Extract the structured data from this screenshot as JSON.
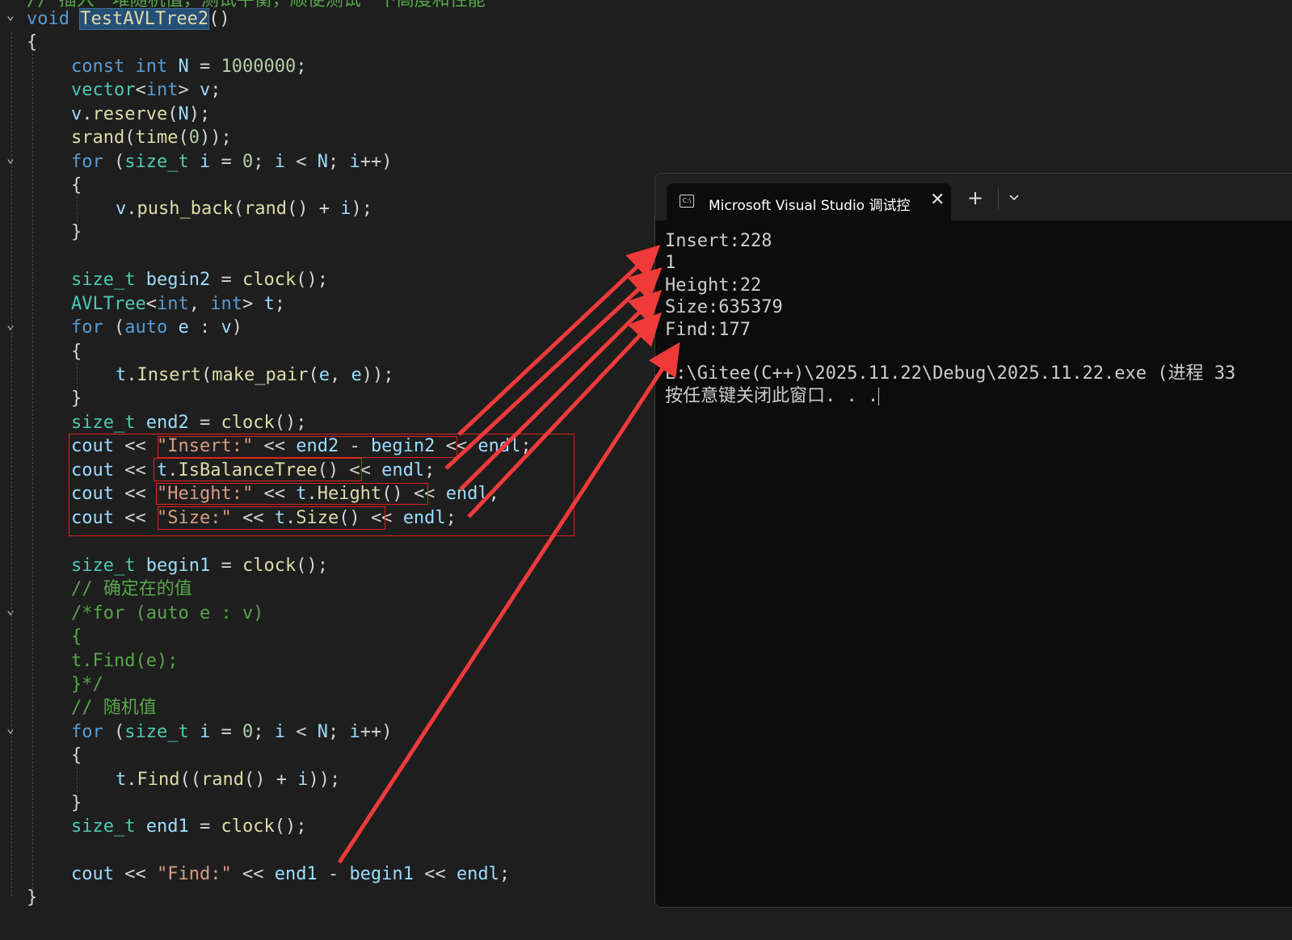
{
  "editor": {
    "header_comment": "// 插入一堆随机值，测试平衡，顺便测试一下高度和性能",
    "func_kw": "void",
    "func_name": "TestAVLTree2",
    "func_parens": "()",
    "lines": [
      "{",
      "const int N = 1000000;",
      "vector<int> v;",
      "v.reserve(N);",
      "srand(time(0));",
      "for (size_t i = 0; i < N; i++)",
      "{",
      "v.push_back(rand() + i);",
      "}",
      "size_t begin2 = clock();",
      "AVLTree<int, int> t;",
      "for (auto e : v)",
      "{",
      "t.Insert(make_pair(e, e));",
      "}",
      "size_t end2 = clock();",
      "cout << \"Insert:\" << end2 - begin2 << endl;",
      "cout << t.IsBalanceTree() << endl;",
      "cout << \"Height:\" << t.Height() << endl;",
      "cout << \"Size:\" << t.Size() << endl;",
      "size_t begin1 = clock();",
      "// 确定在的值",
      "/*for (auto e : v)",
      "{",
      "t.Find(e);",
      "}*/",
      "// 随机值",
      "for (size_t i = 0; i < N; i++)",
      "{",
      "t.Find((rand() + i));",
      "}",
      "size_t end1 = clock();",
      "cout << \"Find:\" << end1 - begin1 << endl;",
      "}"
    ]
  },
  "console": {
    "tab_title": "Microsoft Visual Studio 调试控",
    "icon_label": "C:\\",
    "close_glyph": "✕",
    "new_tab_glyph": "+",
    "output": [
      "Insert:228",
      "1",
      "Height:22",
      "Size:635379",
      "Find:177",
      "",
      "E:\\Gitee(C++)\\2025.11.22\\Debug\\2025.11.22.exe (进程 33",
      "按任意键关闭此窗口. . ."
    ]
  },
  "colors": {
    "arrow": "#f03a3a",
    "highlight_box": "#e0201f",
    "keyword": "#569cd6",
    "type": "#4ec9b0",
    "function": "#dcdcaa",
    "string": "#d69d85",
    "comment": "#57a64a"
  }
}
